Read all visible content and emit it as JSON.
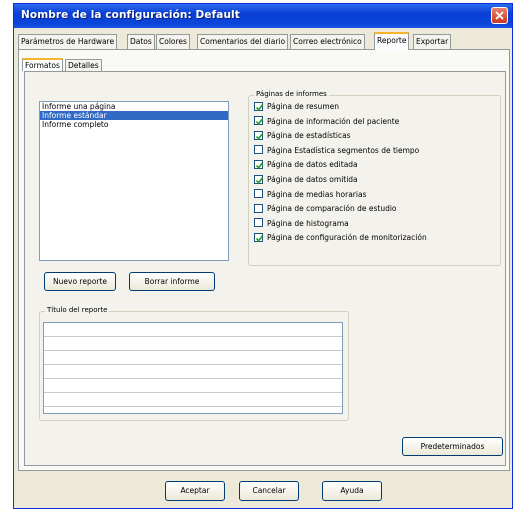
{
  "window": {
    "title": "Nombre de la configuración: Default"
  },
  "tabs": [
    {
      "label": "Parámetros de Hardware"
    },
    {
      "label": "Datos"
    },
    {
      "label": "Colores"
    },
    {
      "label": "Comentarios del diario"
    },
    {
      "label": "Correo electrónico"
    },
    {
      "label": "Reporte"
    },
    {
      "label": "Exportar"
    }
  ],
  "subtabs": [
    {
      "label": "Formatos"
    },
    {
      "label": "Detalles"
    }
  ],
  "report_list": {
    "items": [
      {
        "label": "Informe una página"
      },
      {
        "label": "Informe estándar"
      },
      {
        "label": "Informe completo"
      }
    ],
    "selected": "Informe estándar"
  },
  "pages_group": {
    "label": "Páginas de informes",
    "items": [
      {
        "label": "Página de resumen",
        "checked": true
      },
      {
        "label": "Página de información del paciente",
        "checked": true
      },
      {
        "label": "Página de estadísticas",
        "checked": true
      },
      {
        "label": "Página Estadística segmentos de tiempo",
        "checked": false
      },
      {
        "label": "Página de datos editada",
        "checked": true
      },
      {
        "label": "Página de datos omitida",
        "checked": true
      },
      {
        "label": "Página de medias horarias",
        "checked": false
      },
      {
        "label": "Página de comparación de estudio",
        "checked": false
      },
      {
        "label": "Página de histograma",
        "checked": false
      },
      {
        "label": "Página de configuración de monitorización",
        "checked": true
      }
    ]
  },
  "buttons": {
    "new_report": "Nuevo reporte",
    "delete_report": "Borrar informe",
    "defaults": "Predeterminados",
    "accept": "Aceptar",
    "cancel": "Cancelar",
    "help": "Ayuda"
  },
  "title_group": {
    "label": "Título del reporte"
  }
}
